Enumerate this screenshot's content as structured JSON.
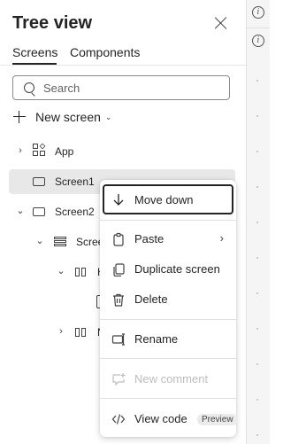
{
  "panel": {
    "title": "Tree view",
    "tabs": [
      {
        "label": "Screens",
        "selected": true
      },
      {
        "label": "Components",
        "selected": false
      }
    ],
    "search": {
      "placeholder": "Search"
    },
    "new_screen_label": "New screen"
  },
  "tree": [
    {
      "label": "App",
      "icon": "app-icon",
      "expanded": false
    },
    {
      "label": "Screen1",
      "icon": "screen-icon",
      "selected": true
    },
    {
      "label": "Screen2",
      "icon": "screen-icon",
      "expanded": true
    },
    {
      "label": "Scree",
      "icon": "container-icon",
      "expanded": true
    },
    {
      "label": "H",
      "icon": "horizontal-container-icon",
      "expanded": true
    },
    {
      "label": "",
      "icon": "clipboard-icon"
    },
    {
      "label": "N",
      "icon": "horizontal-container-icon",
      "expanded": false
    }
  ],
  "context_menu": {
    "items": [
      {
        "label": "Move down",
        "icon": "arrow-down-icon",
        "focused": true
      },
      {
        "label": "Paste",
        "icon": "paste-icon",
        "has_submenu": true
      },
      {
        "label": "Duplicate screen",
        "icon": "duplicate-icon"
      },
      {
        "label": "Delete",
        "icon": "delete-icon"
      },
      {
        "label": "Rename",
        "icon": "rename-icon"
      },
      {
        "label": "New comment",
        "icon": "comment-add-icon",
        "disabled": true
      },
      {
        "label": "View code",
        "icon": "code-icon",
        "badge": "Preview"
      }
    ]
  },
  "colors": {
    "accent": "#242424",
    "selected_row": "#e8e8e8",
    "disabled_text": "#bdbdbd"
  }
}
